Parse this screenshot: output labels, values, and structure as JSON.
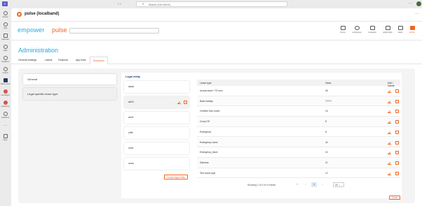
{
  "teams": {
    "search_placeholder": "Search (Ctrl+Alt+E)",
    "rail": [
      {
        "label": "Activity",
        "icon": "bell-icon"
      },
      {
        "label": "Chat",
        "icon": "chat-icon"
      },
      {
        "label": "Calendar",
        "icon": "calendar-icon"
      },
      {
        "label": "Calls",
        "icon": "phone-icon"
      },
      {
        "label": "OneDrive",
        "icon": "cloud-icon"
      },
      {
        "label": "Copilot",
        "icon": "copilot-icon"
      },
      {
        "label": "Admin Cent",
        "icon": "admin-icon"
      },
      {
        "label": "Lite Regist",
        "icon": "app-icon"
      },
      {
        "label": "pulsetemp",
        "icon": "app-icon"
      },
      {
        "label": "pulseloca",
        "icon": "app-icon"
      },
      {
        "label": "",
        "icon": "more-icon"
      },
      {
        "label": "Apps",
        "icon": "apps-icon"
      }
    ]
  },
  "app": {
    "title": "pulse (localband)",
    "brand_left": "empower",
    "brand_right": "pulse",
    "topnav": [
      {
        "label": "home",
        "icon": "home-icon",
        "active": false
      },
      {
        "label": "employee",
        "icon": "person-icon",
        "active": false
      },
      {
        "label": "requests",
        "icon": "inbox-icon",
        "active": false
      },
      {
        "label": "approvals",
        "icon": "approval-icon",
        "active": false
      },
      {
        "label": "stats",
        "icon": "chart-icon",
        "active": false
      },
      {
        "label": "admin",
        "icon": "tools-icon",
        "active": true
      }
    ],
    "page_title": "Administration",
    "tabs": [
      "General settings",
      "Labels",
      "Features",
      "App links",
      "Employee"
    ],
    "active_tab": "Employee"
  },
  "left_menu": [
    "General",
    "Legal specific leave type"
  ],
  "legal_entity": {
    "title": "Legal entity",
    "items": [
      "aaaa",
      "ab01",
      "ssd1",
      "zdfe",
      "zzzb",
      "zzzw"
    ],
    "create_label": "Create legal entity"
  },
  "table": {
    "headers": [
      "Leave type",
      "Value",
      "Edit / Delete"
    ],
    "rows": [
      {
        "type": "Annual leave / TO form",
        "value": "36"
      },
      {
        "type": "Bank Holiday",
        "value": "?????"
      },
      {
        "type": "Certified Sick Leave",
        "value": "16"
      },
      {
        "type": "Comp Off",
        "value": "8"
      },
      {
        "type": "Emergency",
        "value": "8"
      },
      {
        "type": "Emergency Leave",
        "value": "44"
      },
      {
        "type": "Emergency_leave",
        "value": "24"
      },
      {
        "type": "Sickness",
        "value": "21"
      },
      {
        "type": "Test Leave type",
        "value": "12"
      }
    ],
    "pagination": {
      "info": "Showing 1 to 9 of 9 entries",
      "current_page": "1",
      "page_size": "10"
    },
    "close_label": "Close"
  },
  "colors": {
    "accent_orange": "#f26522",
    "brand_blue": "#29a8e0",
    "teams_purple": "#5b5fc7"
  }
}
